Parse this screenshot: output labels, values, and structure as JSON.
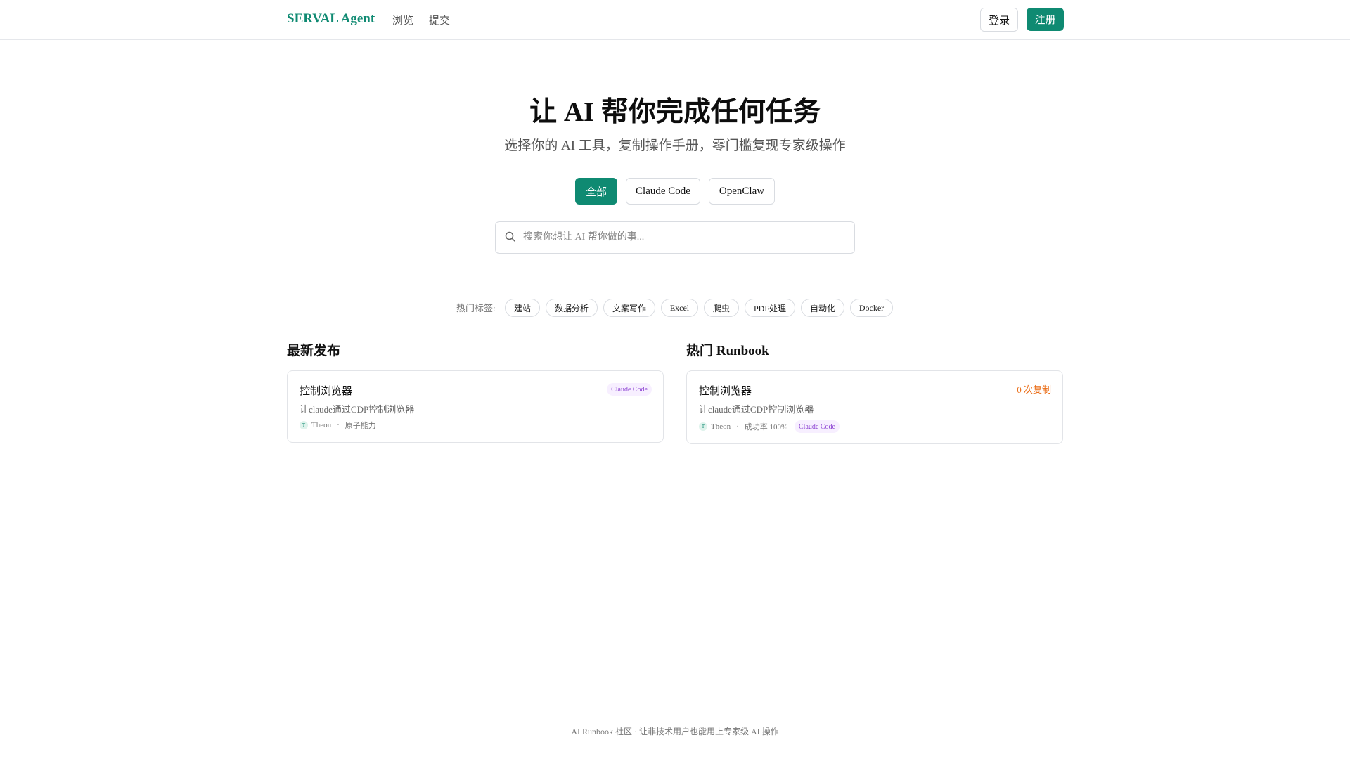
{
  "header": {
    "brand": "SERVAL Agent",
    "nav": [
      "浏览",
      "提交"
    ],
    "login_label": "登录",
    "signup_label": "注册"
  },
  "hero": {
    "title": "让 AI 帮你完成任何任务",
    "subtitle": "选择你的 AI 工具，复制操作手册，零门槛复现专家级操作"
  },
  "filters": [
    "全部",
    "Claude Code",
    "OpenClaw"
  ],
  "search": {
    "placeholder": "搜索你想让 AI 帮你做的事..."
  },
  "tags": {
    "label": "热门标签:",
    "items": [
      "建站",
      "数据分析",
      "文案写作",
      "Excel",
      "爬虫",
      "PDF处理",
      "自动化",
      "Docker"
    ]
  },
  "latest": {
    "title": "最新发布",
    "card": {
      "title": "控制浏览器",
      "desc": "让claude通过CDP控制浏览器",
      "badge": "Claude Code",
      "avatar": "T",
      "author": "Theon",
      "sep": "·",
      "category": "原子能力"
    }
  },
  "hot": {
    "title": "热门 Runbook",
    "card": {
      "title": "控制浏览器",
      "desc": "让claude通过CDP控制浏览器",
      "copies": "0 次复制",
      "avatar": "T",
      "author": "Theon",
      "sep": "·",
      "success": "成功率 100%",
      "badge": "Claude Code"
    }
  },
  "footer": {
    "text": "AI Runbook 社区 · 让非技术用户也能用上专家级 AI 操作"
  },
  "colors": {
    "brand": "#0f8a72",
    "badge": "#8a3fd1",
    "copies": "#ea6a12"
  }
}
